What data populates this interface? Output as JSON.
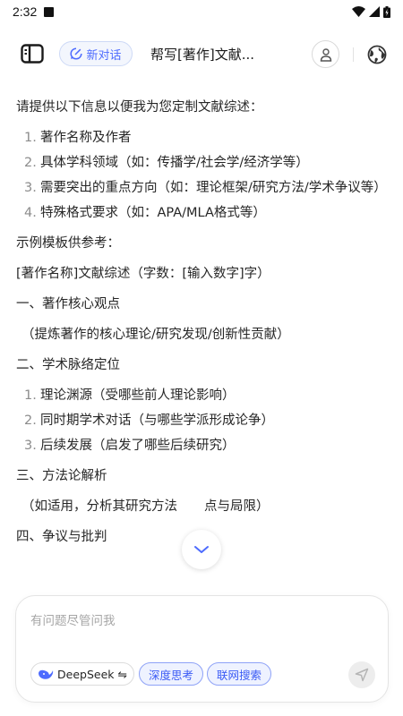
{
  "status_bar": {
    "time": "2:32"
  },
  "header": {
    "new_chat_label": "新对话",
    "title": "帮写[著作]文献..."
  },
  "content": {
    "intro": "请提供以下信息以便我为您定制文献综述：",
    "info_items": [
      {
        "num": "1.",
        "text": "著作名称及作者"
      },
      {
        "num": "2.",
        "text": "具体学科领域（如：传播学/社会学/经济学等）"
      },
      {
        "num": "3.",
        "text": "需要突出的重点方向（如：理论框架/研究方法/学术争议等）"
      },
      {
        "num": "4.",
        "text": "特殊格式要求（如：APA/MLA格式等）"
      }
    ],
    "template_intro": "示例模板供参考：",
    "template_title": "[著作名称]文献综述（字数：[输入数字]字）",
    "section1_heading": "一、著作核心观点",
    "section1_body": "（提炼著作的核心理论/研究发现/创新性贡献）",
    "section2_heading": "二、学术脉络定位",
    "section2_items": [
      {
        "num": "1.",
        "text": "理论渊源（受哪些前人理论影响）"
      },
      {
        "num": "2.",
        "text": "同时期学术对话（与哪些学派形成论争）"
      },
      {
        "num": "3.",
        "text": "后续发展（启发了哪些后续研究）"
      }
    ],
    "section3_heading": "三、方法论解析",
    "section3_body": "（如适用，分析其研究方法",
    "section3_body_tail": "点与局限）",
    "section4_heading": "四、争议与批判"
  },
  "composer": {
    "placeholder": "有问题尽管问我",
    "model_label": "DeepSeek ⇋",
    "deep_think_label": "深度思考",
    "web_search_label": "联网搜索"
  },
  "colors": {
    "accent": "#4d6bfe",
    "toggle_bg": "#eef2ff",
    "send_bg": "#ededed"
  }
}
